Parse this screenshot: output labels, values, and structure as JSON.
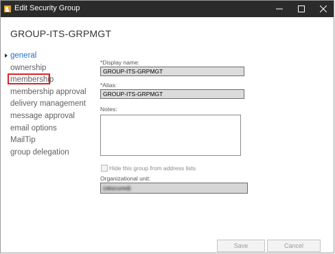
{
  "window": {
    "title": "Edit Security Group",
    "controls": {
      "minimize_icon": "minimize-icon",
      "maximize_icon": "maximize-icon",
      "close_icon": "close-icon"
    }
  },
  "page": {
    "title": "GROUP-ITS-GRPMGT"
  },
  "nav": {
    "items": [
      {
        "label": "general",
        "selected": true
      },
      {
        "label": "ownership",
        "selected": false
      },
      {
        "label": "membership",
        "selected": false,
        "highlighted": true
      },
      {
        "label": "membership approval",
        "selected": false
      },
      {
        "label": "delivery management",
        "selected": false
      },
      {
        "label": "message approval",
        "selected": false
      },
      {
        "label": "email options",
        "selected": false
      },
      {
        "label": "MailTip",
        "selected": false
      },
      {
        "label": "group delegation",
        "selected": false
      }
    ]
  },
  "form": {
    "display_name": {
      "label": "*Display name:",
      "value": "GROUP-ITS-GRPMGT"
    },
    "alias": {
      "label": "*Alias:",
      "value": "GROUP-ITS-GRPMGT"
    },
    "notes": {
      "label": "Notes:",
      "value": ""
    },
    "hide_from_lists": {
      "label": "Hide this group from address lists",
      "checked": false,
      "enabled": false
    },
    "ou": {
      "label": "Organizational unit:",
      "value": "(obscured)"
    }
  },
  "footer": {
    "save_label": "Save",
    "cancel_label": "Cancel"
  },
  "colors": {
    "titlebar": "#2b2b2b",
    "selected_nav": "#1e6fd0",
    "highlight": "#d8232a"
  }
}
